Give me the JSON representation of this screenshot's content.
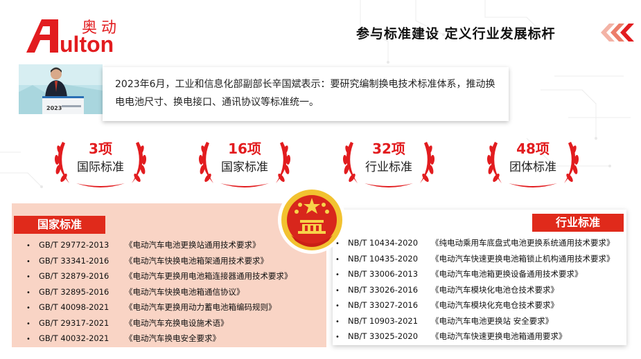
{
  "brand": {
    "cn_name": "奥动",
    "en_name": "ulton",
    "red": "#e21c1f"
  },
  "header": {
    "title": "参与标准建设  定义行业发展标杆"
  },
  "quote": {
    "text": "2023年6月，工业和信息化部副部长辛国斌表示：要研究编制换电技术标准体系，推动换电电池尺寸、换电接口、通讯协议等标准统一。"
  },
  "photo": {
    "banner_text": "2023"
  },
  "stats": [
    {
      "number": "3项",
      "label": "国际标准"
    },
    {
      "number": "16项",
      "label": "国家标准"
    },
    {
      "number": "32项",
      "label": "行业标准"
    },
    {
      "number": "48项",
      "label": "团体标准"
    }
  ],
  "national": {
    "tag": "国家标准",
    "items": [
      {
        "bullet": "•",
        "code": "GB/T 29772-2013",
        "title": "《电动汽车电池更换站通用技术要求》"
      },
      {
        "bullet": "•",
        "code": "GB/T 33341-2016",
        "title": "《电动汽车快换电池箱架通用技术要求》"
      },
      {
        "bullet": "•",
        "code": "GB/T 32879-2016",
        "title": "《电动汽车更换用电池箱连接器通用技术要求》"
      },
      {
        "bullet": "•",
        "code": "GB/T 32895-2016",
        "title": "《电动汽车快换电池箱通信协议》"
      },
      {
        "bullet": "•",
        "code": "GB/T 40098-2021",
        "title": "《电动汽车更换用动力蓄电池箱编码规则》"
      },
      {
        "bullet": "•",
        "code": "GB/T 29317-2021",
        "title": "《电动汽车充换电设施术语》"
      },
      {
        "bullet": "•",
        "code": "GB/T 40032-2021",
        "title": "《电动汽车换电安全要求》"
      }
    ]
  },
  "industry": {
    "tag": "行业标准",
    "items": [
      {
        "bullet": "•",
        "code": "NB/T 10434-2020",
        "title": "《纯电动乘用车底盘式电池更换系统通用技术要求》"
      },
      {
        "bullet": "•",
        "code": "NB/T 10435-2020",
        "title": "《电动汽车快速更换电池箱锁止机构通用技术要求》"
      },
      {
        "bullet": "•",
        "code": "NB/T 33006-2013",
        "title": "《电动汽车电池箱更换设备通用技术要求》"
      },
      {
        "bullet": "•",
        "code": "NB/T 33026-2016",
        "title": "《电动汽车模块化电池仓技术要求》"
      },
      {
        "bullet": "•",
        "code": "NB/T 33027-2016",
        "title": "《电动汽车模块化充电仓技术要求》"
      },
      {
        "bullet": "•",
        "code": "NB/T 10903-2021",
        "title": "《电动汽车电池更换站 安全要求》"
      },
      {
        "bullet": "•",
        "code": "NB/T 33025-2020",
        "title": "《电动汽车快速更换电池箱通用要求》"
      }
    ]
  }
}
